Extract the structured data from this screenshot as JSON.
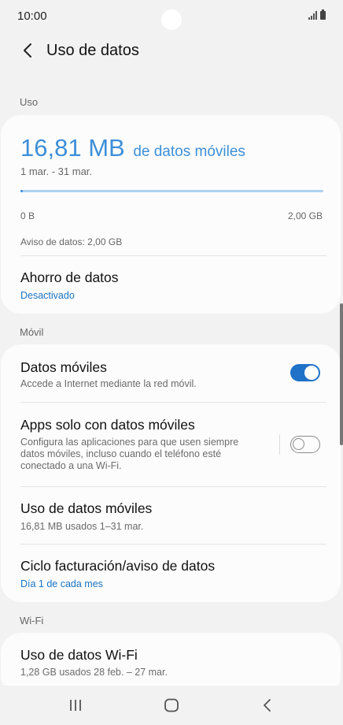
{
  "status": {
    "time": "10:00"
  },
  "header": {
    "title": "Uso de datos"
  },
  "sections": {
    "usage": "Uso",
    "mobile": "Móvil",
    "wifi": "Wi-Fi"
  },
  "usage": {
    "amount": "16,81 MB",
    "unit": "de datos móviles",
    "period": "1 mar. - 31 mar.",
    "bar_min": "0 B",
    "bar_max": "2,00 GB",
    "bar_fraction": 0.008,
    "warning": "Aviso de datos: 2,00 GB"
  },
  "data_saver": {
    "title": "Ahorro de datos",
    "status": "Desactivado"
  },
  "mobile": {
    "mobile_data": {
      "title": "Datos móviles",
      "subtitle": "Accede a Internet mediante la red móvil.",
      "enabled": true
    },
    "apps_only": {
      "title": "Apps solo con datos móviles",
      "subtitle": "Configura las aplicaciones para que usen siempre datos móviles, incluso cuando el teléfono esté conectado a una Wi-Fi.",
      "enabled": false
    },
    "usage": {
      "title": "Uso de datos móviles",
      "subtitle": "16,81 MB usados 1–31 mar."
    },
    "billing": {
      "title": "Ciclo facturación/aviso de datos",
      "subtitle": "Día 1 de cada mes"
    }
  },
  "wifi": {
    "usage": {
      "title": "Uso de datos Wi-Fi",
      "subtitle": "1,28 GB usados 28 feb. – 27 mar."
    }
  },
  "colors": {
    "accent": "#3d8fd9",
    "link": "#1a73c4",
    "toggle_on": "#1f72c7",
    "background": "#f2f2f2"
  },
  "icons": {
    "back": "chevron-left-icon",
    "recents": "recents-icon",
    "home": "home-icon",
    "nav_back": "nav-back-icon"
  }
}
